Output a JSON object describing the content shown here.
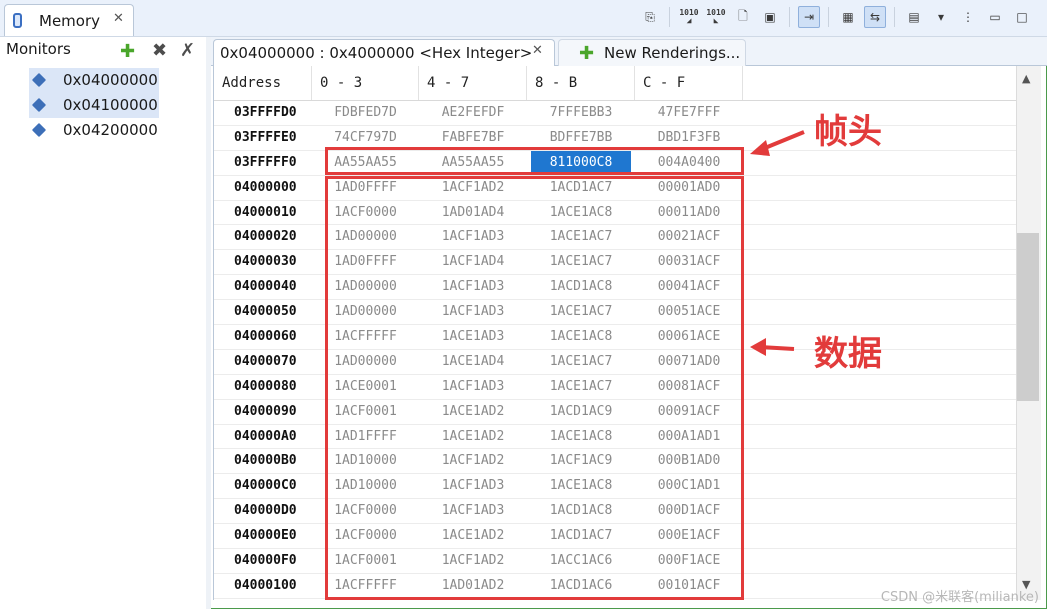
{
  "view_tab": {
    "title": "Memory"
  },
  "toolbar": {
    "icons": [
      "import-icon",
      "binary-view-icon",
      "binary-view2-icon",
      "new-page-icon",
      "export-icon",
      "link-icon",
      "columns-icon",
      "refresh-active-icon",
      "layout-icon",
      "menu-down-icon",
      "more-icon",
      "minimize-icon",
      "maximize-icon"
    ]
  },
  "monitors": {
    "title": "Monitors",
    "items": [
      {
        "label": "0x04000000"
      },
      {
        "label": "0x04100000"
      },
      {
        "label": "0x04200000"
      }
    ]
  },
  "rendering_tabs": {
    "active": "0x04000000 : 0x4000000 <Hex Integer>",
    "new": "New Renderings..."
  },
  "table": {
    "headers": [
      "Address",
      "0 - 3",
      "4 - 7",
      "8 - B",
      "C - F"
    ],
    "rows": [
      [
        "03FFFFD0",
        "FDBFED7D",
        "AE2FEFDF",
        "7FFFEBB3",
        "47FE7FFF"
      ],
      [
        "03FFFFE0",
        "74CF797D",
        "FABFE7BF",
        "BDFFE7BB",
        "DBD1F3FB"
      ],
      [
        "03FFFFF0",
        "AA55AA55",
        "AA55AA55",
        "811000C8",
        "004A0400"
      ],
      [
        "04000000",
        "1AD0FFFF",
        "1ACF1AD2",
        "1ACD1AC7",
        "00001AD0"
      ],
      [
        "04000010",
        "1ACF0000",
        "1AD01AD4",
        "1ACE1AC8",
        "00011AD0"
      ],
      [
        "04000020",
        "1AD00000",
        "1ACF1AD3",
        "1ACE1AC7",
        "00021ACF"
      ],
      [
        "04000030",
        "1AD0FFFF",
        "1ACF1AD4",
        "1ACE1AC7",
        "00031ACF"
      ],
      [
        "04000040",
        "1AD00000",
        "1ACF1AD3",
        "1ACD1AC8",
        "00041ACF"
      ],
      [
        "04000050",
        "1AD00000",
        "1ACF1AD3",
        "1ACE1AC7",
        "00051ACE"
      ],
      [
        "04000060",
        "1ACFFFFF",
        "1ACE1AD3",
        "1ACE1AC8",
        "00061ACE"
      ],
      [
        "04000070",
        "1AD00000",
        "1ACE1AD4",
        "1ACE1AC7",
        "00071AD0"
      ],
      [
        "04000080",
        "1ACE0001",
        "1ACF1AD3",
        "1ACE1AC7",
        "00081ACF"
      ],
      [
        "04000090",
        "1ACF0001",
        "1ACE1AD2",
        "1ACD1AC9",
        "00091ACF"
      ],
      [
        "040000A0",
        "1AD1FFFF",
        "1ACE1AD2",
        "1ACE1AC8",
        "000A1AD1"
      ],
      [
        "040000B0",
        "1AD10000",
        "1ACF1AD2",
        "1ACF1AC9",
        "000B1AD0"
      ],
      [
        "040000C0",
        "1AD10000",
        "1ACF1AD3",
        "1ACE1AC8",
        "000C1AD1"
      ],
      [
        "040000D0",
        "1ACF0000",
        "1ACF1AD3",
        "1ACD1AC8",
        "000D1ACF"
      ],
      [
        "040000E0",
        "1ACF0000",
        "1ACE1AD2",
        "1ACD1AC7",
        "000E1ACF"
      ],
      [
        "040000F0",
        "1ACF0001",
        "1ACF1AD2",
        "1ACC1AC6",
        "000F1ACE"
      ],
      [
        "04000100",
        "1ACFFFFF",
        "1AD01AD2",
        "1ACD1AC6",
        "00101ACF"
      ]
    ],
    "selected": {
      "row": 2,
      "col": 3
    }
  },
  "annotations": {
    "frame_header": "帧头",
    "data": "数据"
  },
  "watermark": "CSDN @米联客(milianke)",
  "colors": {
    "annotation": "#e23b3b",
    "selection": "#1f77d0",
    "accent": "#3d6fb8"
  }
}
